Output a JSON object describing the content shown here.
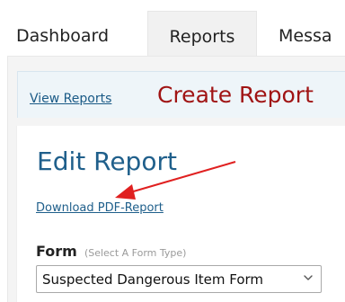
{
  "tabs": [
    {
      "label": "Dashboard",
      "active": false
    },
    {
      "label": "Reports",
      "active": true
    },
    {
      "label": "Messa",
      "active": false
    }
  ],
  "subnav": {
    "view_reports": "View Reports",
    "create_report": "Create Report"
  },
  "main": {
    "title": "Edit Report",
    "download_link": "Download PDF-Report",
    "form_label": "Form",
    "form_hint": "(Select A Form Type)",
    "form_select_value": "Suspected Dangerous Item Form"
  },
  "colors": {
    "tab_active_bg": "#f1f1f1",
    "link_blue": "#1f5f8b",
    "create_red": "#a01414",
    "annotation_arrow": "#e02020"
  },
  "icons": {
    "select_chevron": "chevron-down-icon",
    "annotation": "red-arrow-icon"
  }
}
